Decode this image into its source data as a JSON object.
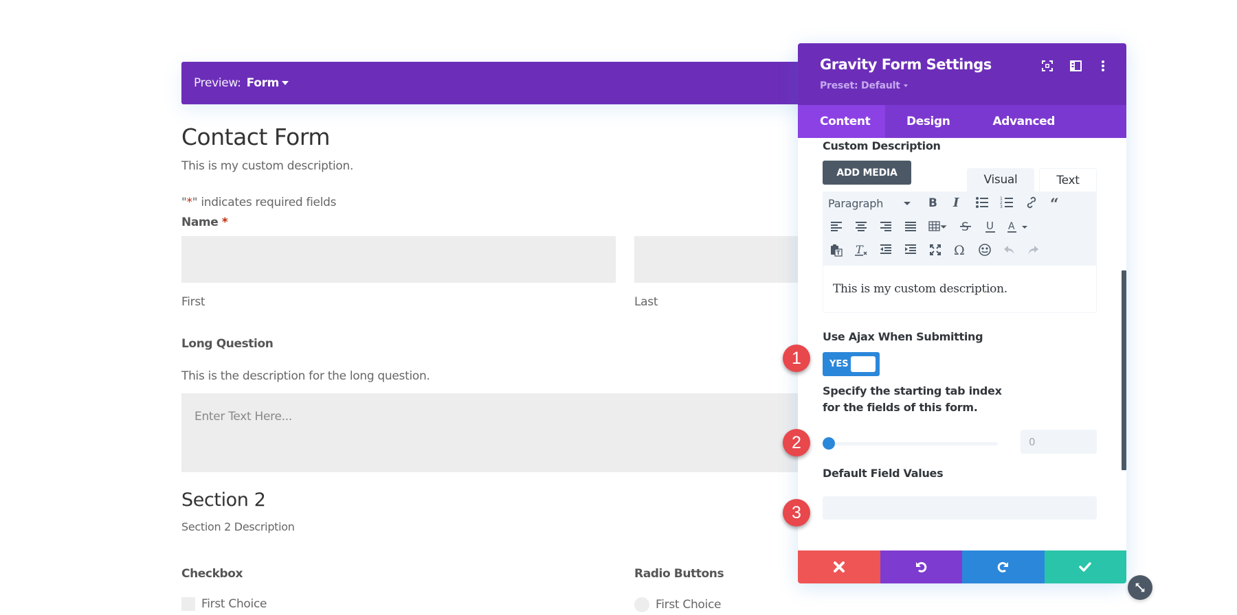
{
  "preview": {
    "label": "Preview:",
    "value": "Form"
  },
  "form": {
    "title": "Contact Form",
    "description": "This is my custom description.",
    "required_note_prefix": "\"",
    "required_note_star": "*",
    "required_note_suffix": "\" indicates required fields",
    "name_label": "Name",
    "required_star": "*",
    "name_first_sublabel": "First",
    "name_last_sublabel": "Last",
    "long_question_label": "Long Question",
    "long_question_description": "This is the description for the long question.",
    "long_question_placeholder": "Enter Text Here...",
    "section_title": "Section 2",
    "section_description": "Section 2 Description",
    "checkbox_label": "Checkbox",
    "checkbox_choices": [
      "First Choice"
    ],
    "radio_label": "Radio Buttons",
    "radio_choices": [
      "First Choice"
    ]
  },
  "panel": {
    "title": "Gravity Form Settings",
    "preset": "Preset: Default",
    "header_icons": [
      "focus-icon",
      "split-view-icon",
      "more-vertical-icon"
    ],
    "tabs": [
      {
        "label": "Content",
        "active": true
      },
      {
        "label": "Design",
        "active": false
      },
      {
        "label": "Advanced",
        "active": false
      }
    ],
    "custom_description": {
      "label": "Custom Description",
      "add_media": "ADD MEDIA",
      "editor_tabs": [
        "Visual",
        "Text"
      ],
      "active_editor_tab": "Visual",
      "format_select": "Paragraph",
      "toolbar_rows": [
        [
          "bold",
          "italic",
          "bullet-list",
          "numbered-list",
          "link",
          "blockquote"
        ],
        [
          "align-left",
          "align-center",
          "align-right",
          "align-justify",
          "table",
          "strikethrough",
          "underline",
          "text-color"
        ],
        [
          "paste-as-text",
          "clear-formatting",
          "outdent",
          "indent",
          "fullscreen",
          "special-character",
          "emoji",
          "undo",
          "redo"
        ]
      ],
      "content": "This is my custom description."
    },
    "ajax": {
      "label": "Use Ajax When Submitting",
      "value": "YES",
      "enabled": true
    },
    "tab_index": {
      "label_line1": "Specify the starting tab index",
      "label_line2": "for the fields of this form.",
      "value": "0",
      "slider_fraction": 0
    },
    "default_values": {
      "label": "Default Field Values",
      "value": ""
    },
    "footer": [
      "cancel",
      "undo",
      "redo",
      "save"
    ]
  },
  "badges": [
    "1",
    "2",
    "3"
  ],
  "colors": {
    "brand_purple": "#6c2eb9",
    "tab_purple": "#7b38d0",
    "tab_active": "#8b41e4",
    "blue": "#2b87da",
    "red": "#ef5555",
    "green": "#29c4a9",
    "dark": "#4c5866",
    "required": "#c02b0a"
  }
}
